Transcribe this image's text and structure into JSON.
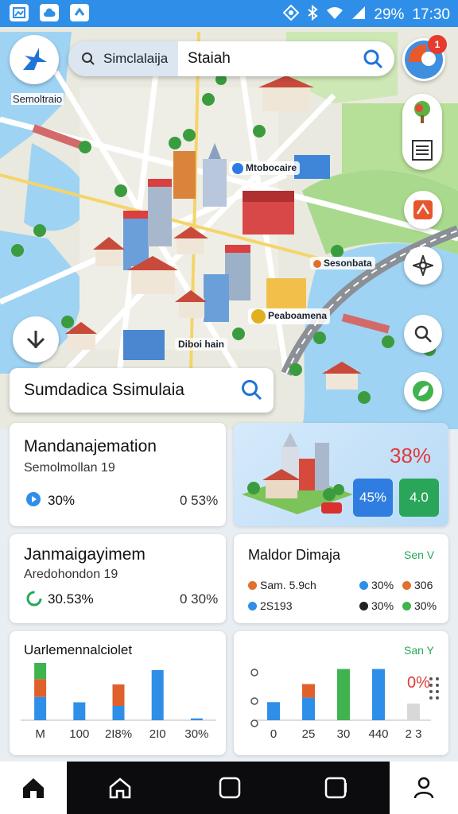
{
  "status_bar": {
    "battery": "29%",
    "time": "17:30"
  },
  "app": {
    "logo_label": "Semoltraio"
  },
  "search": {
    "chip_label": "Simclalaija",
    "value": "Staiah"
  },
  "avatar_badge": "1",
  "map": {
    "labels": [
      {
        "text": "Mtobocaire",
        "color": "#2c7be5"
      },
      {
        "text": "Sesonbata",
        "color": "#e0702c"
      },
      {
        "text": "Peaboamena",
        "color": "#e0b020"
      },
      {
        "text": "Diboi hain",
        "color": "#ffffff"
      }
    ]
  },
  "place_search": {
    "value": "Sumdadica Ssimulaia"
  },
  "cards": {
    "management": {
      "title": "Mandanajemation",
      "subtitle": "Semolmollan 19",
      "stat_left": "30%",
      "stat_right": "0 53%"
    },
    "promo": {
      "percent": "38%",
      "chip_blue": "45%",
      "chip_green": "4.0"
    },
    "janmai": {
      "title": "Janmaigayimem",
      "subtitle": "Aredohondon 19",
      "stat_left": "30.53%",
      "stat_right": "0 30%"
    },
    "maldor": {
      "title": "Maldor Dimaja",
      "tag": "Sen V",
      "legend": [
        {
          "label": "Sam. 5.9ch",
          "color": "#e0702c"
        },
        {
          "label": "30%",
          "color": "#2f8fe8"
        },
        {
          "label": "306",
          "color": "#e0702c"
        },
        {
          "label": "2S193",
          "color": "#2f8fe8"
        },
        {
          "label": "30%",
          "color": "#222222"
        },
        {
          "label": "30%",
          "color": "#3fb34f"
        }
      ]
    },
    "usage": {
      "title": "Uarlemennalciolet",
      "ticks": [
        "M",
        "100",
        "2I8%",
        "2I0",
        "30%"
      ]
    },
    "trend": {
      "tag": "San Y",
      "percent": "0%",
      "ticks": [
        "0",
        "25",
        "30",
        "440",
        "2 3"
      ]
    }
  },
  "chart_data": [
    {
      "type": "bar",
      "title": "Uarlemennalciolet",
      "categories": [
        "M",
        "100",
        "2I8%",
        "2I0",
        "30%"
      ],
      "series": [
        {
          "values": [
            13,
            10,
            8,
            28,
            1
          ],
          "color": "#2f8fe8"
        },
        {
          "values": [
            10,
            0,
            12,
            0,
            0
          ],
          "color": "#e0602c"
        },
        {
          "values": [
            9,
            0,
            0,
            0,
            0
          ],
          "color": "#3fb34f"
        }
      ],
      "ylim": [
        0,
        32
      ]
    },
    {
      "type": "bar",
      "categories": [
        "0",
        "25",
        "30",
        "440",
        "2 3"
      ],
      "series": [
        {
          "values": [
            12,
            15,
            0,
            34,
            0
          ],
          "color": "#2f8fe8"
        },
        {
          "values": [
            0,
            9,
            0,
            0,
            0
          ],
          "color": "#e0602c"
        },
        {
          "values": [
            0,
            0,
            34,
            0,
            0
          ],
          "color": "#3fb34f"
        },
        {
          "values": [
            0,
            0,
            0,
            0,
            11
          ],
          "color": "#d8d8d8"
        }
      ],
      "ylim": [
        0,
        38
      ]
    }
  ]
}
